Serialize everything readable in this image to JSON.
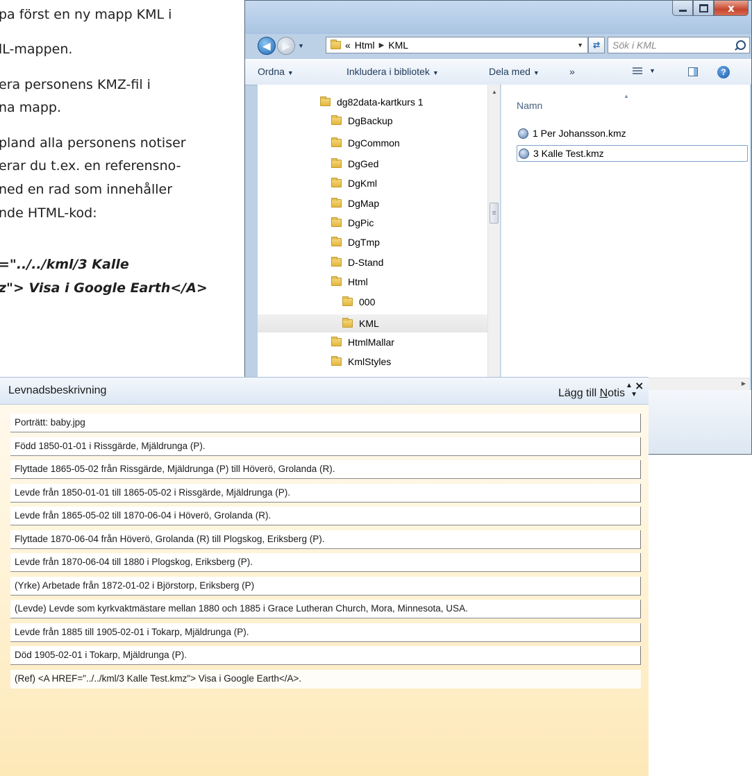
{
  "doc": {
    "lines": [
      "pa först en ny mapp KML i",
      "lL-mappen.",
      "era personens KMZ-fil i",
      "na mapp.",
      "pland alla personens notiser",
      "erar du t.ex. en referensno-",
      "ned en rad som innehåller",
      "nde HTML-kod:"
    ],
    "code_lines": [
      "=\"../../kml/3 Kalle",
      "z\"> Visa i Google Earth</A>"
    ]
  },
  "explorer": {
    "window_controls": {
      "close": "x"
    },
    "address": {
      "chevron": "«",
      "crumbs": [
        "Html",
        "KML"
      ]
    },
    "search_placeholder": "Sök i KML",
    "commands": {
      "organize": "Ordna",
      "include": "Inkludera i bibliotek",
      "share": "Dela med",
      "more": "»"
    },
    "tree": [
      {
        "label": "dg82data-kartkurs 1"
      },
      {
        "label": "DgBackup"
      },
      {
        "label": "DgCommon"
      },
      {
        "label": "DgGed"
      },
      {
        "label": "DgKml"
      },
      {
        "label": "DgMap"
      },
      {
        "label": "DgPic"
      },
      {
        "label": "DgTmp"
      },
      {
        "label": "D-Stand"
      },
      {
        "label": "Html"
      },
      {
        "label": "000"
      },
      {
        "label": "KML",
        "selected": true
      },
      {
        "label": "HtmlMallar"
      },
      {
        "label": "KmlStyles"
      }
    ],
    "column_header": "Namn",
    "files": [
      {
        "name": "1 Per Johansson.kmz"
      },
      {
        "name": "3 Kalle Test.kmz",
        "selected": true
      }
    ]
  },
  "panel": {
    "title": "Levnadsbeskrivning",
    "add_note_prefix": "Lägg till ",
    "add_note_key": "N",
    "add_note_rest": "otis",
    "close": "×",
    "notes": [
      "Porträtt: baby.jpg",
      "Född 1850-01-01 i Rissgärde, Mjäldrunga (P).",
      "Flyttade 1865-05-02 från Rissgärde, Mjäldrunga (P) till Höverö, Grolanda (R).",
      "Levde från 1850-01-01 till 1865-05-02 i Rissgärde, Mjäldrunga (P).",
      "Levde från 1865-05-02 till 1870-06-04 i Höverö, Grolanda (R).",
      "Flyttade 1870-06-04 från Höverö, Grolanda (R) till Plogskog, Eriksberg (P).",
      "Levde från 1870-06-04 till 1880 i Plogskog, Eriksberg (P).",
      "(Yrke) Arbetade från 1872-01-02 i Björstorp, Eriksberg (P)",
      "(Levde) Levde som kyrkvaktmästare mellan 1880 och 1885 i Grace Lutheran Church, Mora, Minnesota, USA.",
      "Levde från 1885 till 1905-02-01 i Tokarp, Mjäldrunga (P).",
      "Död 1905-02-01 i Tokarp, Mjäldrunga (P).",
      "(Ref) <A HREF=\"../../kml/3 Kalle Test.kmz\"> Visa i Google Earth</A>."
    ]
  }
}
